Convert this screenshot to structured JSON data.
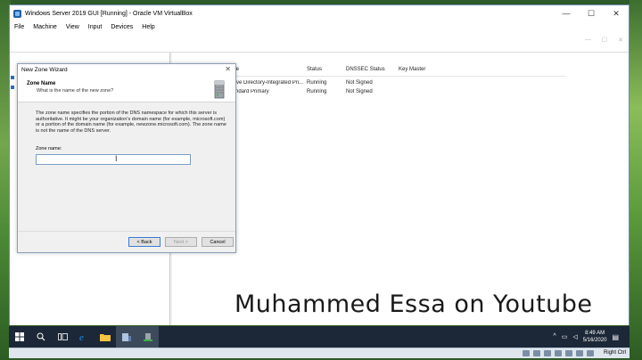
{
  "vbox": {
    "title": "Windows Server 2019 GUI [Running] - Oracle VM VirtualBox",
    "controls": {
      "minimize": "—",
      "maximize": "☐",
      "close": "✕"
    },
    "menu": [
      "File",
      "Machine",
      "View",
      "Input",
      "Devices",
      "Help"
    ],
    "host_key": "Right Ctrl"
  },
  "mmc": {
    "ghost_controls": {
      "minimize": "—",
      "maximize": "☐",
      "close": "✕"
    },
    "columns": {
      "type": "Type",
      "status": "Status",
      "dnssec": "DNSSEC Status",
      "keymaster": "Key Master"
    },
    "rows": [
      {
        "type": "Active Directory-Integrated Pri...",
        "status": "Running",
        "dnssec": "Not Signed",
        "keymaster": ""
      },
      {
        "type": "Standard Primary",
        "status": "Running",
        "dnssec": "Not Signed",
        "keymaster": ""
      }
    ]
  },
  "wizard": {
    "title": "New Zone Wizard",
    "close": "✕",
    "heading": "Zone Name",
    "subheading": "What is the name of the new zone?",
    "description": "The zone name specifies the portion of the DNS namespace for which this server is authoritative. It might be your organization's domain name (for example, microsoft.com) or a portion of the domain name (for example, newzone.microsoft.com). The zone name is not the name of the DNS server.",
    "zone_label": "Zone name:",
    "zone_value": "",
    "back_label": "< Back",
    "next_label": "Next >",
    "cancel_label": "Cancel"
  },
  "watermark": "Muhammed Essa on Youtube",
  "taskbar": {
    "clock_time": "8:49 AM",
    "clock_date": "5/16/2020",
    "notification_icon": "notification-icon"
  }
}
